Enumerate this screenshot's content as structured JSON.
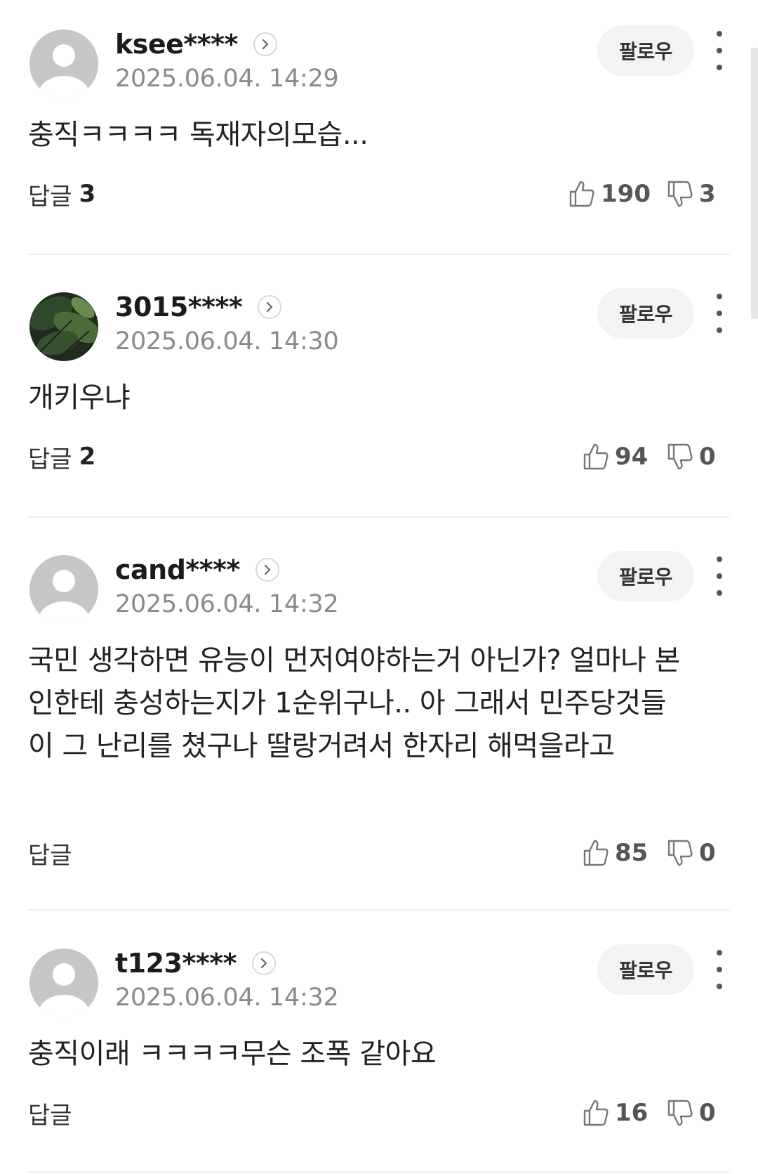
{
  "comments": [
    {
      "username": "ksee****",
      "timestamp": "2025.06.04. 14:29",
      "follow_label": "팔로우",
      "text": "충직ㅋㅋㅋㅋ 독재자의모습...",
      "reply_label": "답글",
      "reply_count": "3",
      "likes": "190",
      "dislikes": "3",
      "avatar": "default-avatar"
    },
    {
      "username": "3015****",
      "timestamp": "2025.06.04. 14:30",
      "follow_label": "팔로우",
      "text": "개키우냐",
      "reply_label": "답글",
      "reply_count": "2",
      "likes": "94",
      "dislikes": "0",
      "avatar": "leaf-photo-avatar"
    },
    {
      "username": "cand****",
      "timestamp": "2025.06.04. 14:32",
      "follow_label": "팔로우",
      "text": "국민 생각하면 유능이 먼저여야하는거 아닌가? 얼마나 본인한테 충성하는지가 1순위구나.. 아 그래서 민주당것들이 그 난리를 쳤구나 딸랑거려서 한자리 해먹을라고",
      "reply_label": "답글",
      "reply_count": "",
      "likes": "85",
      "dislikes": "0",
      "avatar": "default-avatar"
    },
    {
      "username": "t123****",
      "timestamp": "2025.06.04. 14:32",
      "follow_label": "팔로우",
      "text": "충직이래 ㅋㅋㅋㅋ무슨 조폭 같아요",
      "reply_label": "답글",
      "reply_count": "",
      "likes": "16",
      "dislikes": "0",
      "avatar": "default-avatar"
    }
  ],
  "colors": {
    "follow_bg": "#f3f3f3",
    "divider": "#efefef",
    "timestamp": "#8a8a8a",
    "icon": "#555555"
  }
}
